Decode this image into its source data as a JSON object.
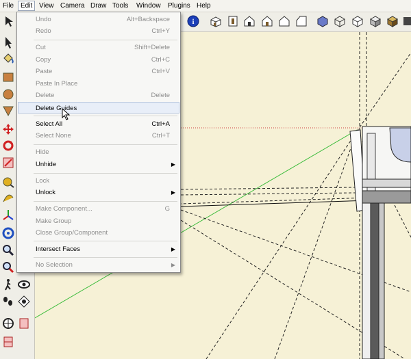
{
  "menubar": {
    "items": [
      "File",
      "Edit",
      "View",
      "Camera",
      "Draw",
      "Tools",
      "Window",
      "Plugins",
      "Help"
    ]
  },
  "edit_menu": {
    "items": [
      {
        "label": "Undo",
        "shortcut": "Alt+Backspace",
        "enabled": false,
        "submenu": false
      },
      {
        "label": "Redo",
        "shortcut": "Ctrl+Y",
        "enabled": false,
        "submenu": false
      },
      {
        "label": "Cut",
        "shortcut": "Shift+Delete",
        "enabled": false,
        "submenu": false
      },
      {
        "label": "Copy",
        "shortcut": "Ctrl+C",
        "enabled": false,
        "submenu": false
      },
      {
        "label": "Paste",
        "shortcut": "Ctrl+V",
        "enabled": false,
        "submenu": false
      },
      {
        "label": "Paste In Place",
        "shortcut": "",
        "enabled": false,
        "submenu": false
      },
      {
        "label": "Delete",
        "shortcut": "Delete",
        "enabled": false,
        "submenu": false
      },
      {
        "label": "Delete Guides",
        "shortcut": "",
        "enabled": true,
        "submenu": false,
        "hovered": true
      },
      {
        "label": "Select All",
        "shortcut": "Ctrl+A",
        "enabled": true,
        "submenu": false
      },
      {
        "label": "Select None",
        "shortcut": "Ctrl+T",
        "enabled": false,
        "submenu": false
      },
      {
        "label": "Hide",
        "shortcut": "",
        "enabled": false,
        "submenu": false
      },
      {
        "label": "Unhide",
        "shortcut": "",
        "enabled": true,
        "submenu": true
      },
      {
        "label": "Lock",
        "shortcut": "",
        "enabled": false,
        "submenu": false
      },
      {
        "label": "Unlock",
        "shortcut": "",
        "enabled": true,
        "submenu": true
      },
      {
        "label": "Make Component...",
        "shortcut": "G",
        "enabled": false,
        "submenu": false
      },
      {
        "label": "Make Group",
        "shortcut": "",
        "enabled": false,
        "submenu": false
      },
      {
        "label": "Close Group/Component",
        "shortcut": "",
        "enabled": false,
        "submenu": false
      },
      {
        "label": "Intersect Faces",
        "shortcut": "",
        "enabled": true,
        "submenu": true
      },
      {
        "label": "No Selection",
        "shortcut": "",
        "enabled": false,
        "submenu": true
      }
    ]
  },
  "icons": {
    "toolbar": [
      "info-icon",
      "iso-view-icon",
      "top-view-icon",
      "front-view-icon",
      "right-view-icon",
      "back-view-icon",
      "left-view-icon",
      "xray-icon",
      "wireframe-icon",
      "hidden-line-icon",
      "shaded-icon",
      "shaded-texture-icon",
      "monochrome-icon"
    ],
    "left": [
      "select-arrow-icon",
      "paint-bucket-icon",
      "rectangle-icon",
      "circle-icon",
      "polygon-icon",
      "move-icon",
      "rotate-icon",
      "scale-icon",
      "tape-measure-icon",
      "protractor-icon",
      "axes-icon",
      "orbit-icon",
      "zoom-icon",
      "zoom-window-icon",
      "walk-icon",
      "look-around-icon",
      "footprints-icon",
      "position-camera-icon",
      "section-plane-icon",
      "section-display-icon"
    ]
  },
  "colors": {
    "viewport_bg": "#f6f1d6",
    "green_axis": "#3cbc3c",
    "red_axis": "#d04040",
    "menu_hover": "#e8eef8"
  }
}
